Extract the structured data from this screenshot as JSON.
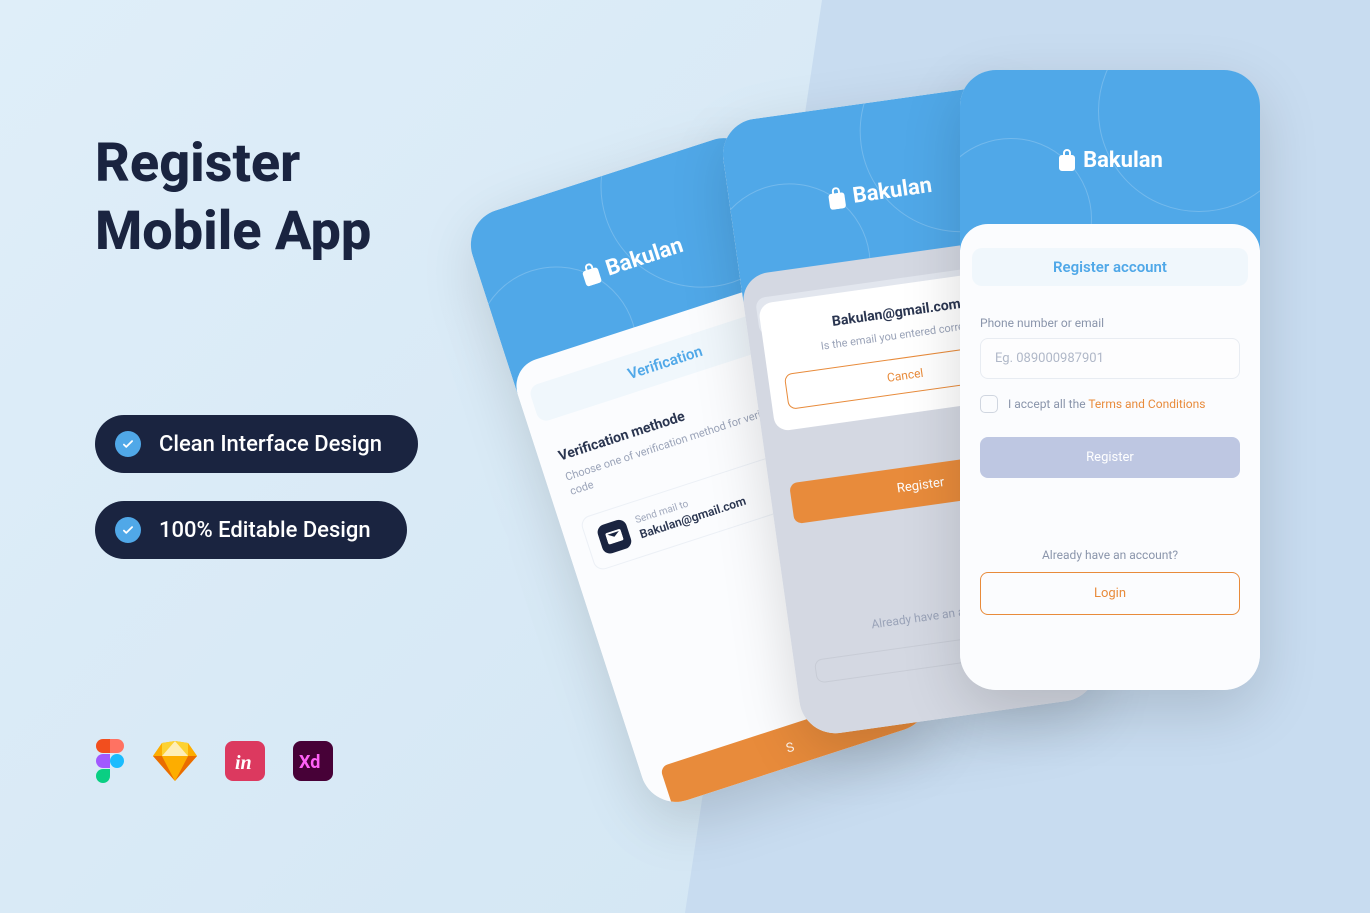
{
  "title_line1": "Register",
  "title_line2": "Mobile App",
  "features": [
    "Clean Interface Design",
    "100% Editable Design"
  ],
  "brand_name": "Bakulan",
  "colors": {
    "primary": "#50a8e8",
    "accent": "#e88b3b",
    "dark": "#1a2440"
  },
  "phone1": {
    "title": "Verification",
    "section_title": "Verification methode",
    "section_desc": "Choose one of verification method for verification code",
    "mail_label": "Send mail to",
    "mail_value": "Bakulan@gmail.com"
  },
  "phone2": {
    "title": "Register account",
    "modal_title": "Bakulan@gmail.com",
    "modal_desc": "Is the email you entered correct?",
    "cancel": "Cancel",
    "already": "Already have an account?",
    "register": "Register"
  },
  "phone3": {
    "title": "Register account",
    "field_label": "Phone number or email",
    "placeholder": "Eg. 089000987901",
    "terms_prefix": "I accept all the ",
    "terms_link": "Terms and Conditions",
    "register": "Register",
    "already": "Already have an account?",
    "login": "Login"
  },
  "tool_icons": [
    "Figma",
    "Sketch",
    "InVision",
    "Adobe XD"
  ]
}
